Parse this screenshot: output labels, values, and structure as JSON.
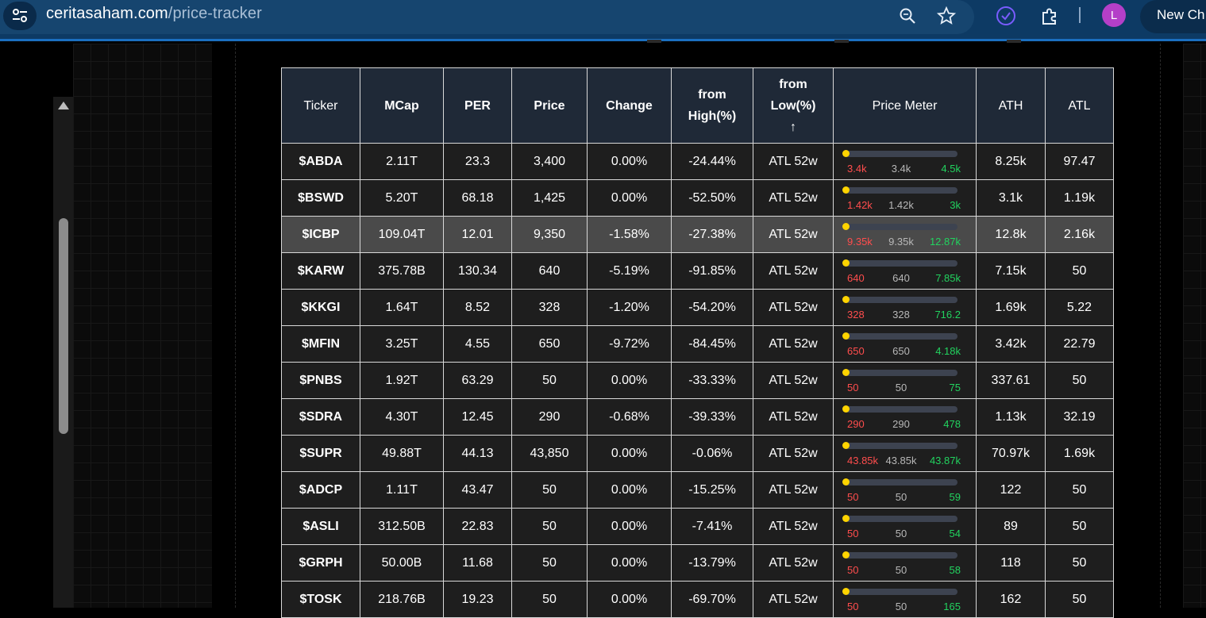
{
  "browser": {
    "url_host": "ceritasaham.com",
    "url_path": "/price-tracker",
    "profile_initial": "L",
    "new_chat_label": "New Ch"
  },
  "table": {
    "headers": {
      "ticker": "Ticker",
      "mcap": "MCap",
      "per": "PER",
      "price": "Price",
      "change": "Change",
      "from_high_1": "from",
      "from_high_2": "High(%)",
      "from_low_1": "from",
      "from_low_2": "Low(%)",
      "from_low_sort": "↑",
      "meter": "Price Meter",
      "ath": "ATH",
      "atl": "ATL"
    },
    "rows": [
      {
        "ticker": "$ABDA",
        "mcap": "2.11T",
        "per": "23.3",
        "price": "3,400",
        "change": "0.00%",
        "from_high": "-24.44%",
        "from_low": "ATL 52w",
        "meter_lo": "3.4k",
        "meter_cur": "3.4k",
        "meter_hi": "4.5k",
        "ath": "8.25k",
        "atl": "97.47"
      },
      {
        "ticker": "$BSWD",
        "mcap": "5.20T",
        "per": "68.18",
        "price": "1,425",
        "change": "0.00%",
        "from_high": "-52.50%",
        "from_low": "ATL 52w",
        "meter_lo": "1.42k",
        "meter_cur": "1.42k",
        "meter_hi": "3k",
        "ath": "3.1k",
        "atl": "1.19k"
      },
      {
        "ticker": "$ICBP",
        "mcap": "109.04T",
        "per": "12.01",
        "price": "9,350",
        "change": "-1.58%",
        "from_high": "-27.38%",
        "from_low": "ATL 52w",
        "meter_lo": "9.35k",
        "meter_cur": "9.35k",
        "meter_hi": "12.87k",
        "ath": "12.8k",
        "atl": "2.16k"
      },
      {
        "ticker": "$KARW",
        "mcap": "375.78B",
        "per": "130.34",
        "price": "640",
        "change": "-5.19%",
        "from_high": "-91.85%",
        "from_low": "ATL 52w",
        "meter_lo": "640",
        "meter_cur": "640",
        "meter_hi": "7.85k",
        "ath": "7.15k",
        "atl": "50"
      },
      {
        "ticker": "$KKGI",
        "mcap": "1.64T",
        "per": "8.52",
        "price": "328",
        "change": "-1.20%",
        "from_high": "-54.20%",
        "from_low": "ATL 52w",
        "meter_lo": "328",
        "meter_cur": "328",
        "meter_hi": "716.2",
        "ath": "1.69k",
        "atl": "5.22"
      },
      {
        "ticker": "$MFIN",
        "mcap": "3.25T",
        "per": "4.55",
        "price": "650",
        "change": "-9.72%",
        "from_high": "-84.45%",
        "from_low": "ATL 52w",
        "meter_lo": "650",
        "meter_cur": "650",
        "meter_hi": "4.18k",
        "ath": "3.42k",
        "atl": "22.79"
      },
      {
        "ticker": "$PNBS",
        "mcap": "1.92T",
        "per": "63.29",
        "price": "50",
        "change": "0.00%",
        "from_high": "-33.33%",
        "from_low": "ATL 52w",
        "meter_lo": "50",
        "meter_cur": "50",
        "meter_hi": "75",
        "ath": "337.61",
        "atl": "50"
      },
      {
        "ticker": "$SDRA",
        "mcap": "4.30T",
        "per": "12.45",
        "price": "290",
        "change": "-0.68%",
        "from_high": "-39.33%",
        "from_low": "ATL 52w",
        "meter_lo": "290",
        "meter_cur": "290",
        "meter_hi": "478",
        "ath": "1.13k",
        "atl": "32.19"
      },
      {
        "ticker": "$SUPR",
        "mcap": "49.88T",
        "per": "44.13",
        "price": "43,850",
        "change": "0.00%",
        "from_high": "-0.06%",
        "from_low": "ATL 52w",
        "meter_lo": "43.85k",
        "meter_cur": "43.85k",
        "meter_hi": "43.87k",
        "ath": "70.97k",
        "atl": "1.69k"
      },
      {
        "ticker": "$ADCP",
        "mcap": "1.11T",
        "per": "43.47",
        "price": "50",
        "change": "0.00%",
        "from_high": "-15.25%",
        "from_low": "ATL 52w",
        "meter_lo": "50",
        "meter_cur": "50",
        "meter_hi": "59",
        "ath": "122",
        "atl": "50"
      },
      {
        "ticker": "$ASLI",
        "mcap": "312.50B",
        "per": "22.83",
        "price": "50",
        "change": "0.00%",
        "from_high": "-7.41%",
        "from_low": "ATL 52w",
        "meter_lo": "50",
        "meter_cur": "50",
        "meter_hi": "54",
        "ath": "89",
        "atl": "50"
      },
      {
        "ticker": "$GRPH",
        "mcap": "50.00B",
        "per": "11.68",
        "price": "50",
        "change": "0.00%",
        "from_high": "-13.79%",
        "from_low": "ATL 52w",
        "meter_lo": "50",
        "meter_cur": "50",
        "meter_hi": "58",
        "ath": "118",
        "atl": "50"
      },
      {
        "ticker": "$TOSK",
        "mcap": "218.76B",
        "per": "19.23",
        "price": "50",
        "change": "0.00%",
        "from_high": "-69.70%",
        "from_low": "ATL 52w",
        "meter_lo": "50",
        "meter_cur": "50",
        "meter_hi": "165",
        "ath": "162",
        "atl": "50"
      }
    ],
    "highlighted_ticker": "$ICBP",
    "colors": {
      "ticker": "#2d9cff",
      "negative": "#ff4d4d",
      "meter_high": "#22d35f",
      "meter_dot": "#ffd400",
      "header_bg": "#1f2937"
    }
  }
}
